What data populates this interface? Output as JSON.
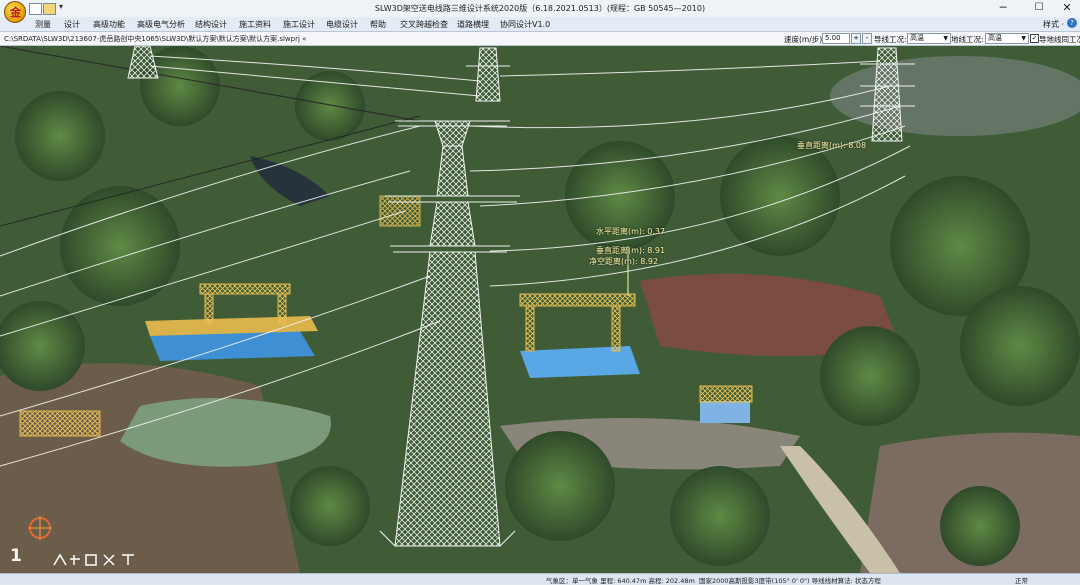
{
  "window": {
    "title": "SLW3D架空送电线路三维设计系统2020版（6.18.2021.0513）(规程：GB 50545—2010)",
    "minimize": "─",
    "maximize": "☐",
    "close": "✕"
  },
  "quick_access": {
    "dropdown": "▾"
  },
  "menu": [
    "测量",
    "设计",
    "高级功能",
    "高级电气分析",
    "结构设计",
    "施工资料",
    "施工设计",
    "电缆设计",
    "帮助",
    "交叉跨越检查",
    "道路横埋",
    "协同设计V1.0"
  ],
  "menu_right": {
    "style_label": "样式 ·",
    "help": "?"
  },
  "pathbar": {
    "path": "C:\\SRDATA\\SLW3D\\213607-虎岳路创中央1065\\SLW3D\\默认方案\\默认方案\\默认方案.slwprj  «",
    "speed_label": "速度(m/步):",
    "speed_value": "5.00",
    "spin_up": "+",
    "spin_down": "-",
    "conductor_label": "导线工况:",
    "conductor_value": "高温",
    "ground_label": "地线工况:",
    "ground_value": "高温",
    "sync_checkbox": "✓",
    "sync_label": "导地线同工况"
  },
  "viewport": {
    "annotations": {
      "clearance_top": "垂直距离(m): 8.08",
      "horizontal": "水平距离(m): 0.37",
      "vertical": "垂直距离(m): 8.91",
      "net": "净空距离(m): 8.92"
    },
    "watermark_logo": "1"
  },
  "statusbar": {
    "left": "气象区：单一气象 里程: 640.47m 高程: 202.48m",
    "middle": "国家2000高斯投影3度带(105° 0' 0\") 导线线材算法: 状态方程",
    "right": "正常"
  },
  "colors": {
    "tower": "#f2f2f2",
    "platform": "#d9b24c",
    "blue_pad": "#3f8fd4",
    "annotation": "#fff7a8"
  }
}
